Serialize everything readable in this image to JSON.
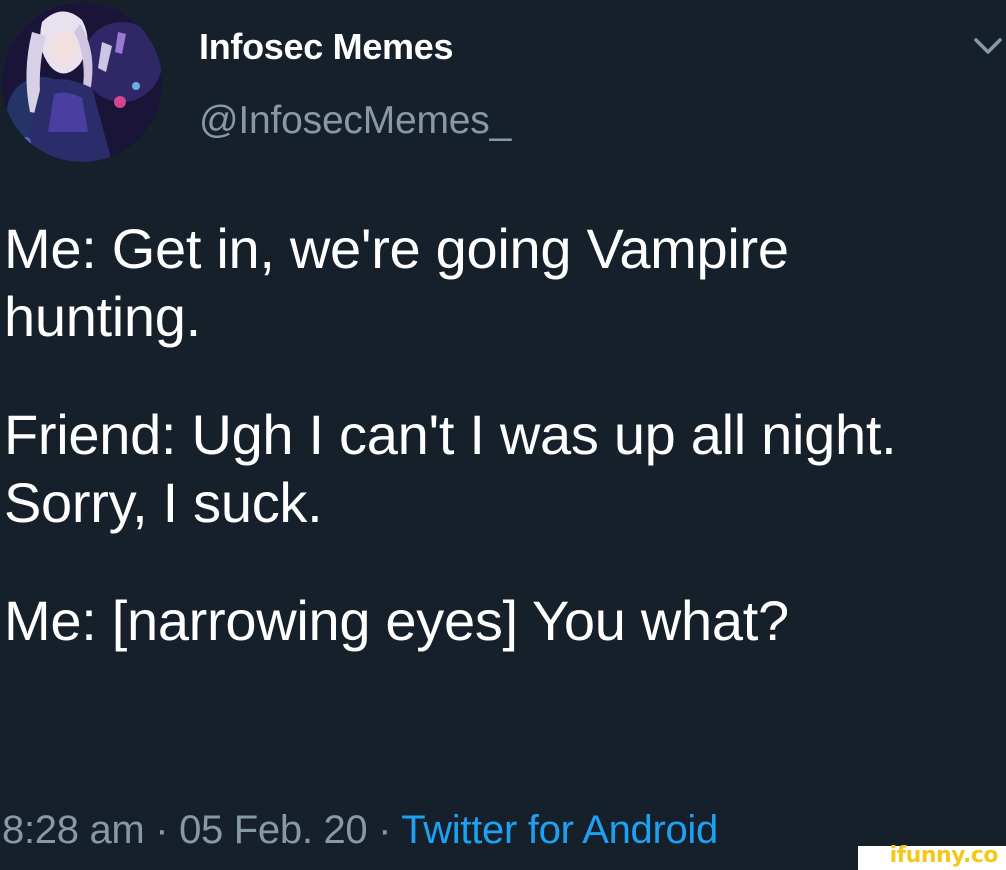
{
  "account": {
    "display_name": "Infosec Memes",
    "handle": "@InfosecMemes_",
    "avatar_icon": "anime-character-avatar"
  },
  "menu": {
    "icon": "chevron-down-icon"
  },
  "tweet": {
    "paragraphs": [
      "Me: Get in, we're going Vampire hunting.",
      "Friend: Ugh I can't I was up all night. Sorry, I suck.",
      "Me: [narrowing eyes] You what?"
    ]
  },
  "meta": {
    "time": "8:28 am",
    "separator": " · ",
    "date": "05 Feb. 20",
    "source": "Twitter for Android"
  },
  "watermark": {
    "text": "ifunny.co"
  },
  "colors": {
    "background": "#15202b",
    "text_primary": "#ffffff",
    "text_secondary": "#8899a6",
    "link": "#1da1f2",
    "watermark": "#f4c81a"
  }
}
